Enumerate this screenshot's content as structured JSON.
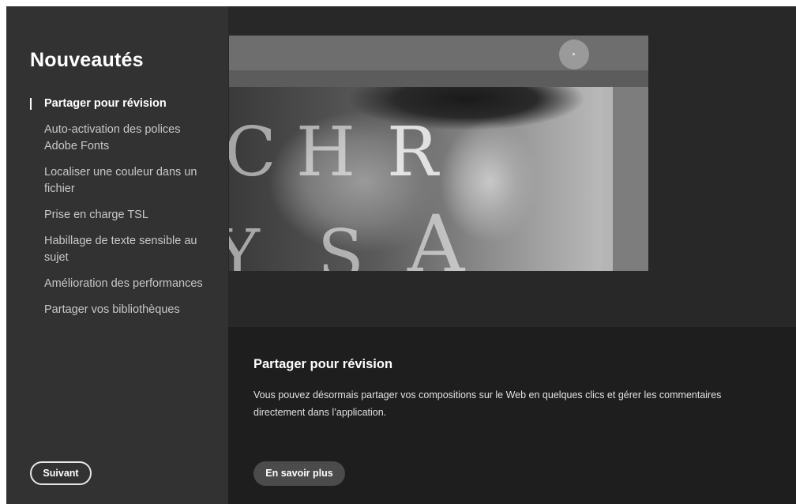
{
  "sidebar": {
    "title": "Nouveautés",
    "items": [
      {
        "label": "Partager pour révision",
        "active": true
      },
      {
        "label": "Auto-activation des polices Adobe Fonts",
        "active": false
      },
      {
        "label": "Localiser une couleur dans un fichier",
        "active": false
      },
      {
        "label": "Prise en charge TSL",
        "active": false
      },
      {
        "label": "Habillage de texte sensible au sujet",
        "active": false
      },
      {
        "label": "Amélioration des performances",
        "active": false
      },
      {
        "label": "Partager vos bibliothèques",
        "active": false
      }
    ],
    "next_button": "Suivant"
  },
  "preview": {
    "letters": [
      "C",
      "H",
      "R",
      "Y",
      "S",
      "A"
    ]
  },
  "content": {
    "title": "Partager pour révision",
    "description": "Vous pouvez désormais partager vos compositions sur le Web en quelques clics et gérer les commentaires directement dans l’application.",
    "learn_more_button": "En savoir plus"
  },
  "colors": {
    "sidebar_bg": "#323232",
    "main_bg": "#1e1e1e",
    "hero_bg": "#282828",
    "button_bg": "#4b4b4b",
    "text_primary": "#ffffff"
  }
}
